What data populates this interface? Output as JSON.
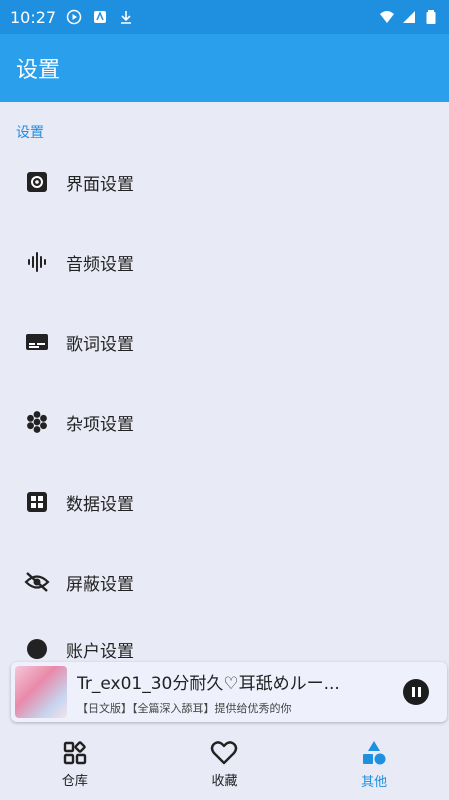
{
  "status_bar": {
    "time": "10:27"
  },
  "app_bar": {
    "title": "设置"
  },
  "section": {
    "title": "设置"
  },
  "settings": [
    {
      "label": "界面设置",
      "icon": "gear-icon"
    },
    {
      "label": "音频设置",
      "icon": "audio-wave-icon"
    },
    {
      "label": "歌词设置",
      "icon": "subtitles-icon"
    },
    {
      "label": "杂项设置",
      "icon": "hexagon-cluster-icon"
    },
    {
      "label": "数据设置",
      "icon": "grid-icon"
    },
    {
      "label": "屏蔽设置",
      "icon": "eye-off-icon"
    },
    {
      "label": "账户设置",
      "icon": "account-icon"
    }
  ],
  "player": {
    "title": "Tr_ex01_30分耐久♡耳舐めルー...",
    "subtitle": "【日文版】【全篇深入舔耳】提供给优秀的你"
  },
  "bottom_nav": [
    {
      "label": "仓库",
      "icon": "library-icon",
      "active": false
    },
    {
      "label": "收藏",
      "icon": "heart-icon",
      "active": false
    },
    {
      "label": "其他",
      "icon": "shapes-icon",
      "active": true
    }
  ],
  "colors": {
    "accent": "#1f8fe0",
    "app_bar": "#2aa0ec",
    "background": "#e8eaf6"
  }
}
